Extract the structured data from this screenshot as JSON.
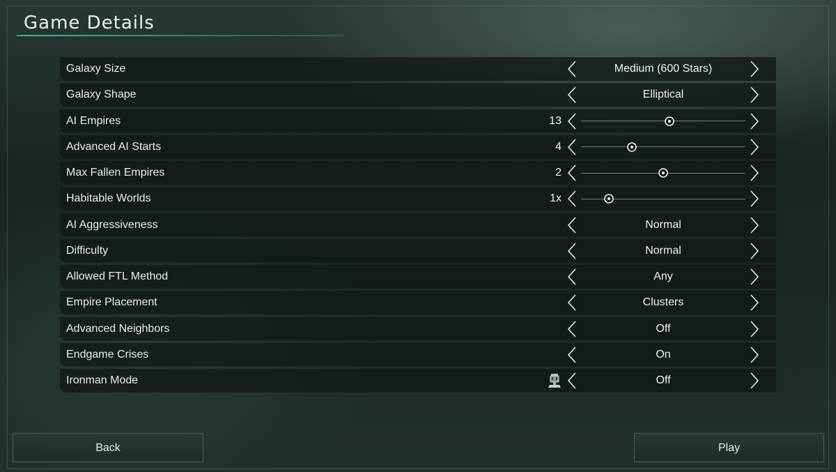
{
  "title": "Game Details",
  "colors": {
    "accent": "#3cc8aa",
    "row_bg": "#121817",
    "text": "#e8ecea"
  },
  "settings": [
    {
      "label": "Galaxy Size",
      "type": "select",
      "value": "Medium (600 Stars)"
    },
    {
      "label": "Galaxy Shape",
      "type": "select",
      "value": "Elliptical"
    },
    {
      "label": "AI Empires",
      "type": "slider",
      "value": "13",
      "position": 0.54
    },
    {
      "label": "Advanced AI Starts",
      "type": "slider",
      "value": "4",
      "position": 0.31
    },
    {
      "label": "Max Fallen Empires",
      "type": "slider",
      "value": "2",
      "position": 0.5
    },
    {
      "label": "Habitable Worlds",
      "type": "slider",
      "value": "1x",
      "position": 0.17
    },
    {
      "label": "AI Aggressiveness",
      "type": "select",
      "value": "Normal"
    },
    {
      "label": "Difficulty",
      "type": "select",
      "value": "Normal"
    },
    {
      "label": "Allowed FTL Method",
      "type": "select",
      "value": "Any"
    },
    {
      "label": "Empire Placement",
      "type": "select",
      "value": "Clusters"
    },
    {
      "label": "Advanced Neighbors",
      "type": "select",
      "value": "Off"
    },
    {
      "label": "Endgame Crises",
      "type": "select",
      "value": "On"
    },
    {
      "label": "Ironman Mode",
      "type": "select",
      "value": "Off",
      "icon": "ironman-icon"
    }
  ],
  "buttons": {
    "back_label": "Back",
    "play_label": "Play"
  }
}
